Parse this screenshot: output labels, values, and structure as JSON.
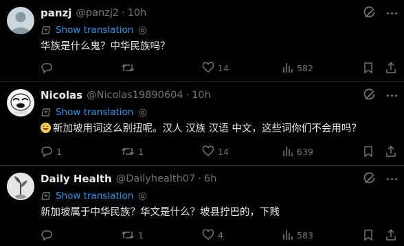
{
  "tweets": [
    {
      "name": "panzj",
      "handle": "@panzj2",
      "dot": "·",
      "time": "10h",
      "translate_label": "Show translation",
      "text": "华族是什么鬼？中华民族吗？",
      "has_emoji": false,
      "replies": "",
      "retweets": "",
      "likes": "14",
      "views": "582",
      "avatar_icon": "default-avatar-icon"
    },
    {
      "name": "Nicolas",
      "handle": "@Nicolas19890604",
      "dot": "·",
      "time": "10h",
      "translate_label": "Show translation",
      "text": "新加坡用词这么别扭呢。汉人 汉族 汉语 中文，这些词你们不会用吗？",
      "has_emoji": true,
      "emoji_icon": "grinning-sweat-emoji",
      "replies": "1",
      "retweets": "1",
      "likes": "14",
      "views": "639",
      "avatar_icon": "meme-face-avatar"
    },
    {
      "name": "Daily Health",
      "handle": "@Dailyhealth07",
      "dot": "·",
      "time": "6h",
      "translate_label": "Show translation",
      "text": "新加坡属于中华民族？华文是什么？坡县拧巴的，下贱",
      "has_emoji": false,
      "replies": "",
      "retweets": "1",
      "likes": "4",
      "views": "583",
      "avatar_icon": "plant-photo-avatar"
    }
  ]
}
